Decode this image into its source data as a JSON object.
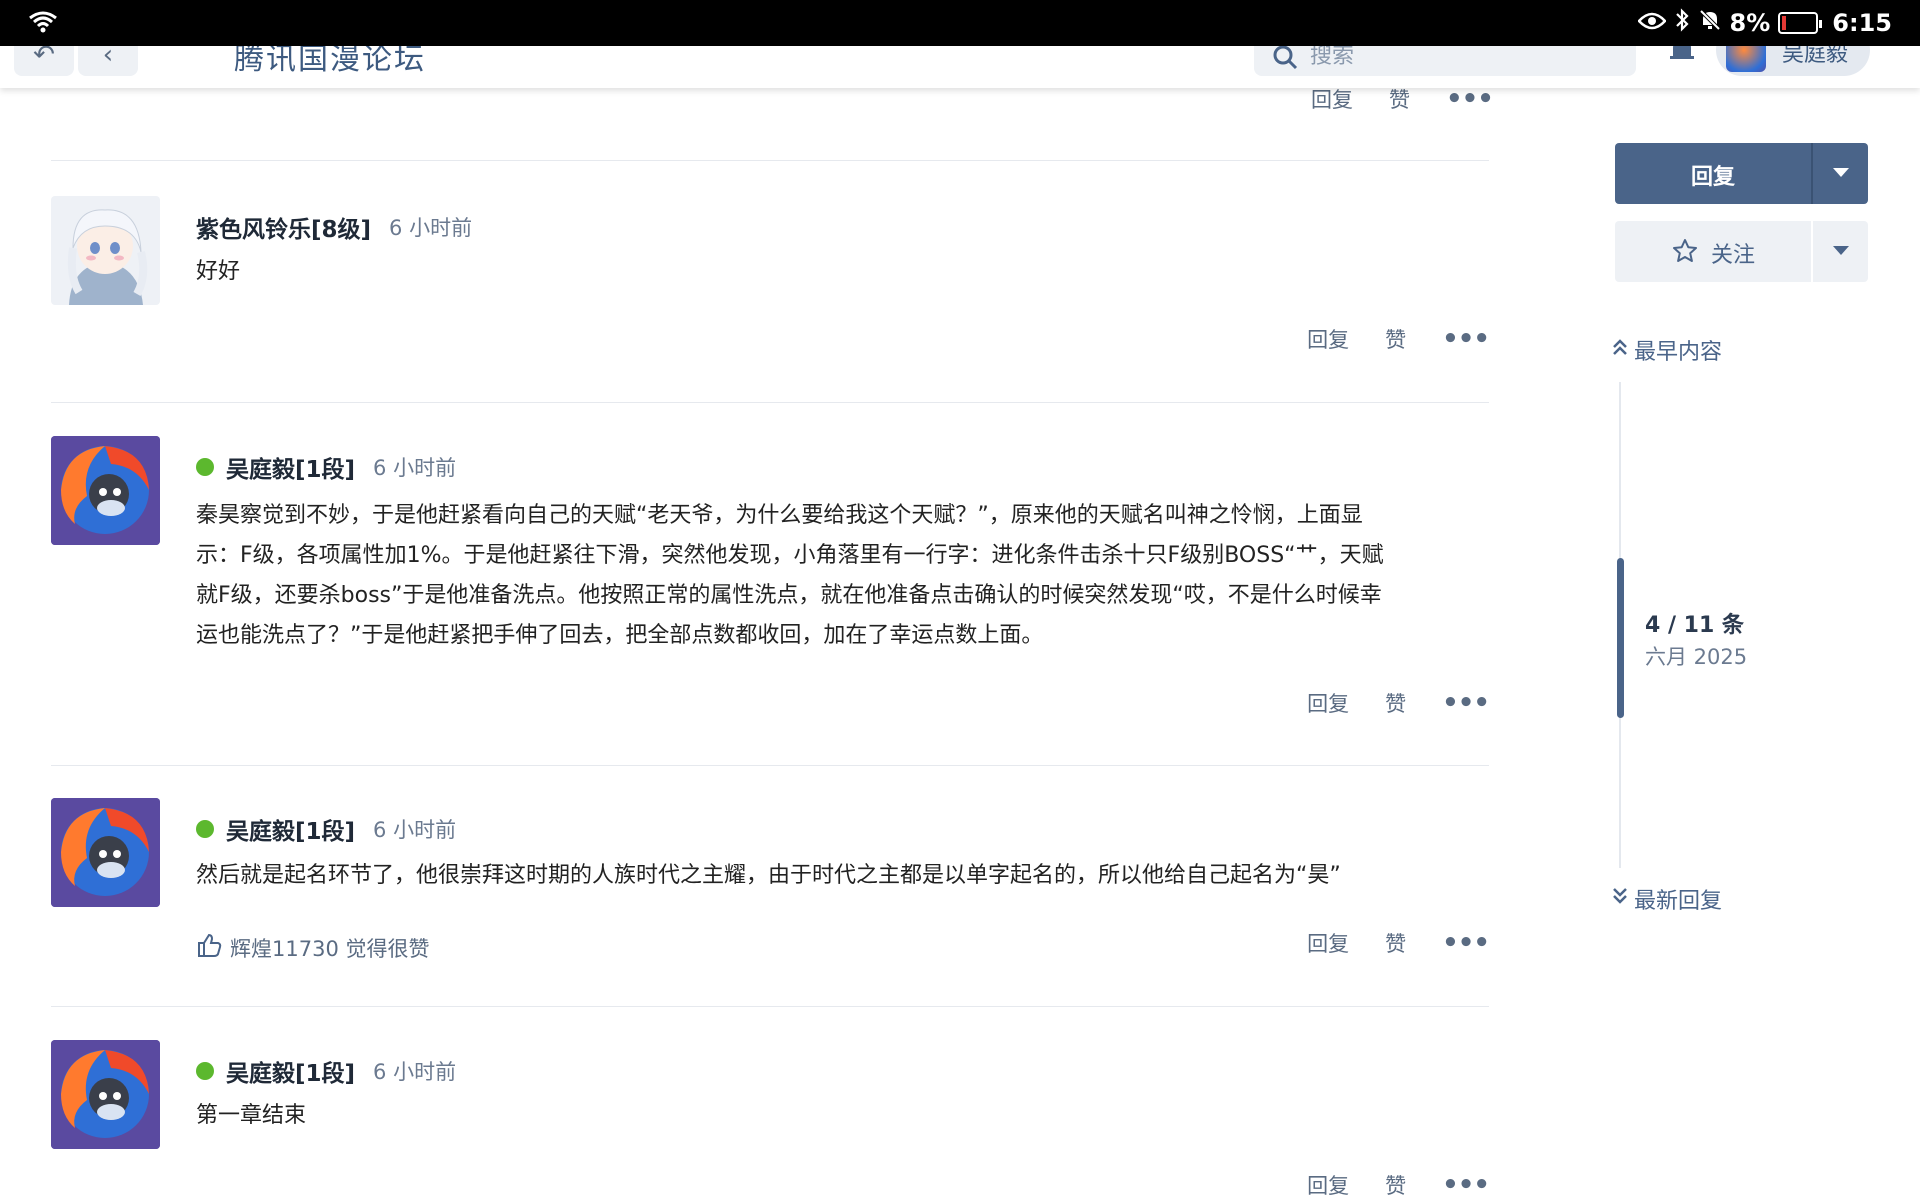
{
  "status_bar": {
    "battery": "8%",
    "time": "6:15"
  },
  "header": {
    "site_title": "腾讯国漫论坛",
    "search_placeholder": "搜索",
    "user_name": "吴庭毅"
  },
  "top_actions": {
    "reply": "回复",
    "like": "赞",
    "more": "•••"
  },
  "posts": [
    {
      "author": "紫色风铃乐[8级]",
      "online": false,
      "time": "6 小时前",
      "content": "好好",
      "reply": "回复",
      "like": "赞",
      "more": "•••"
    },
    {
      "author": "吴庭毅[1段]",
      "online": true,
      "time": "6 小时前",
      "content_lines": [
        "秦昊察觉到不妙，于是他赶紧看向自己的天赋“老天爷，为什么要给我这个天赋？”，原来他的天赋名叫神之怜悯，上面显",
        "示：F级，各项属性加1%。于是他赶紧往下滑，突然他发现，小角落里有一行字：进化条件击杀十只F级别BOSS“艹，天赋",
        "就F级，还要杀boss”于是他准备洗点。他按照正常的属性洗点，就在他准备点击确认的时候突然发现“哎，不是什么时候幸",
        "运也能洗点了？”于是他赶紧把手伸了回去，把全部点数都收回，加在了幸运点数上面。"
      ],
      "reply": "回复",
      "like": "赞",
      "more": "•••"
    },
    {
      "author": "吴庭毅[1段]",
      "online": true,
      "time": "6 小时前",
      "content": "然后就是起名环节了，他很崇拜这时期的人族时代之主耀，由于时代之主都是以单字起名的，所以他给自己起名为“昊”",
      "likes_text": "辉煌11730 觉得很赞",
      "reply": "回复",
      "like": "赞",
      "more": "•••"
    },
    {
      "author": "吴庭毅[1段]",
      "online": true,
      "time": "6 小时前",
      "content": "第一章结束",
      "reply": "回复",
      "like": "赞",
      "more": "•••"
    }
  ],
  "sidebar": {
    "reply_button": "回复",
    "follow_button": "关注",
    "earliest": "最早内容",
    "latest": "最新回复",
    "position": "4 / 11 条",
    "date": "六月 2025"
  },
  "colors": {
    "accent": "#4a6489",
    "online": "#5cb82e",
    "status_bar": "#000000"
  }
}
